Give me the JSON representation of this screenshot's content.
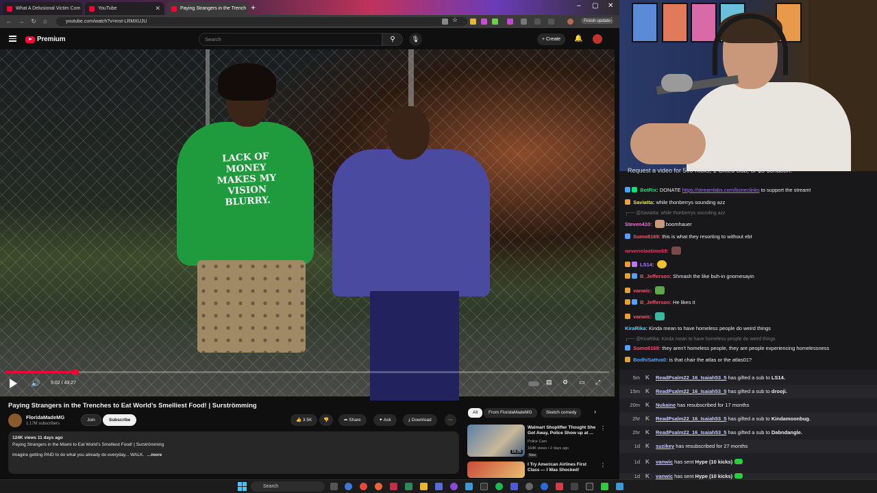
{
  "browser": {
    "tabs": [
      {
        "title": "What A Delusional Victim Com"
      },
      {
        "title": "YouTube"
      },
      {
        "title": "Paying Strangers in the Trench"
      }
    ],
    "url": "youtube.com/watch?v=mst-LRMXUJU",
    "finish_update": "Finish update"
  },
  "youtube": {
    "logo_text": "Premium",
    "search_placeholder": "Search",
    "create_label": "Create",
    "hoodie_text": "LACK OF MONEY MAKES MY VISION BLURRY.",
    "time_display": "5:02 / 43:27",
    "progress_fraction": 0.116,
    "video_title": "Paying Strangers in the Trenches to Eat World’s Smelliest Food! | Surströmming",
    "channel": {
      "name": "FloridaMadeMG",
      "subscribers": "1.17M subscribers"
    },
    "join_label": "Join",
    "subscribe_label": "Subscribe",
    "actions": {
      "likes": "3.5K",
      "share": "Share",
      "ask": "Ask",
      "download": "Download"
    },
    "description": {
      "meta": "124K views  11 days ago",
      "line1": "Paying Strangers in the Miami to Eat World’s Smelliest Food! | Surströmming",
      "line2": "Imagine getting PAID to do what you already do everyday... WALK.",
      "more": "...more"
    },
    "chips": {
      "all": "All",
      "from": "From FloridaMadeMG",
      "sketch": "Sketch comedy"
    },
    "recommendations": [
      {
        "title": "Walmart Shoplifter Thought She Got Away, Police Show up at ...",
        "channel": "Police Cam",
        "meta": "164K views • 2 days ago",
        "badge": "New",
        "duration": "16:25"
      },
      {
        "title": "I Try American Airlines First Class — I Was Shocked!",
        "channel": "",
        "meta": "",
        "badge": "",
        "duration": ""
      }
    ]
  },
  "chat": {
    "banner": "Request a video for 500 Kicks, 1 Gifted Sub, or $5 donation.",
    "messages": [
      {
        "user": "BotRix:",
        "user_color": "#00e676",
        "pre": "DONATE ",
        "link": "https://streamlabs.com/boneclinks",
        "text": " to support the stream!"
      },
      {
        "user": "Saviatta:",
        "user_color": "#e4e445",
        "text": " while thonberrys sounding azz"
      },
      {
        "reply": "@Saviatta: while thonberrys sounding azz"
      },
      {
        "user": "Steven410:",
        "user_color": "#ff6bd6",
        "text": " boomhauer"
      },
      {
        "user": "Sumo8169:",
        "user_color": "#ff4e6e",
        "text": " this is what they resorting to without ebt"
      },
      {
        "user": "neverrelaxtime69:",
        "user_color": "#ff2e63",
        "text": ""
      },
      {
        "user": "LS14:",
        "user_color": "#b57bff",
        "text": ""
      },
      {
        "user": "B_Jefferson:",
        "user_color": "#ff4e6e",
        "text": " Shmash the like buh-in gnomesayin"
      },
      {
        "user": "vanwic:",
        "user_color": "#ff4e6e",
        "text": ""
      },
      {
        "user": "B_Jefferson:",
        "user_color": "#ff4e6e",
        "text": " He likes it"
      },
      {
        "user": "vanwic:",
        "user_color": "#ff4e6e",
        "text": ""
      },
      {
        "user": "KiraRika:",
        "user_color": "#54d3ff",
        "text": " Kinda mean to have homeless people do weird things"
      },
      {
        "reply": "@KiraRika: Kinda mean to have homeless people do weird things"
      },
      {
        "user": "Sumo8169:",
        "user_color": "#ff4e6e",
        "text": " they aren't homeless people, they are people experiencing homelessness"
      },
      {
        "user": "BodhiSattva0:",
        "user_color": "#4fa3ff",
        "text": " is that chair the atlas or the atlas01?"
      }
    ]
  },
  "feed": [
    {
      "ago": "5m",
      "name": "ReadPsalm22_16_Isaiah53_5",
      "action": " has gifted a sub to ",
      "target": "LS14."
    },
    {
      "ago": "15m",
      "name": "ReadPsalm22_16_Isaiah53_5",
      "action": " has gifted a sub to ",
      "target": "drooji."
    },
    {
      "ago": "20m",
      "name": "Nukaine",
      "action": " has resubscribed for 17 months",
      "target": ""
    },
    {
      "ago": "2hr",
      "name": "ReadPsalm22_16_Isaiah53_5",
      "action": " has gifted a sub to ",
      "target": "Kindamoonbug."
    },
    {
      "ago": "2hr",
      "name": "ReadPsalm22_16_Isaiah53_5",
      "action": " has gifted a sub to ",
      "target": "Dabndangle."
    },
    {
      "ago": "1d",
      "name": "suzikey",
      "action": " has resubscribed for 27 months",
      "target": ""
    },
    {
      "ago": "1d",
      "name": "vanwic",
      "action": " has sent ",
      "target": "Hype (10 kicks)"
    },
    {
      "ago": "1d",
      "name": "vanwic",
      "action": " has sent ",
      "target": "Hype (10 kicks)"
    }
  ],
  "taskbar": {
    "search_label": "Search"
  }
}
